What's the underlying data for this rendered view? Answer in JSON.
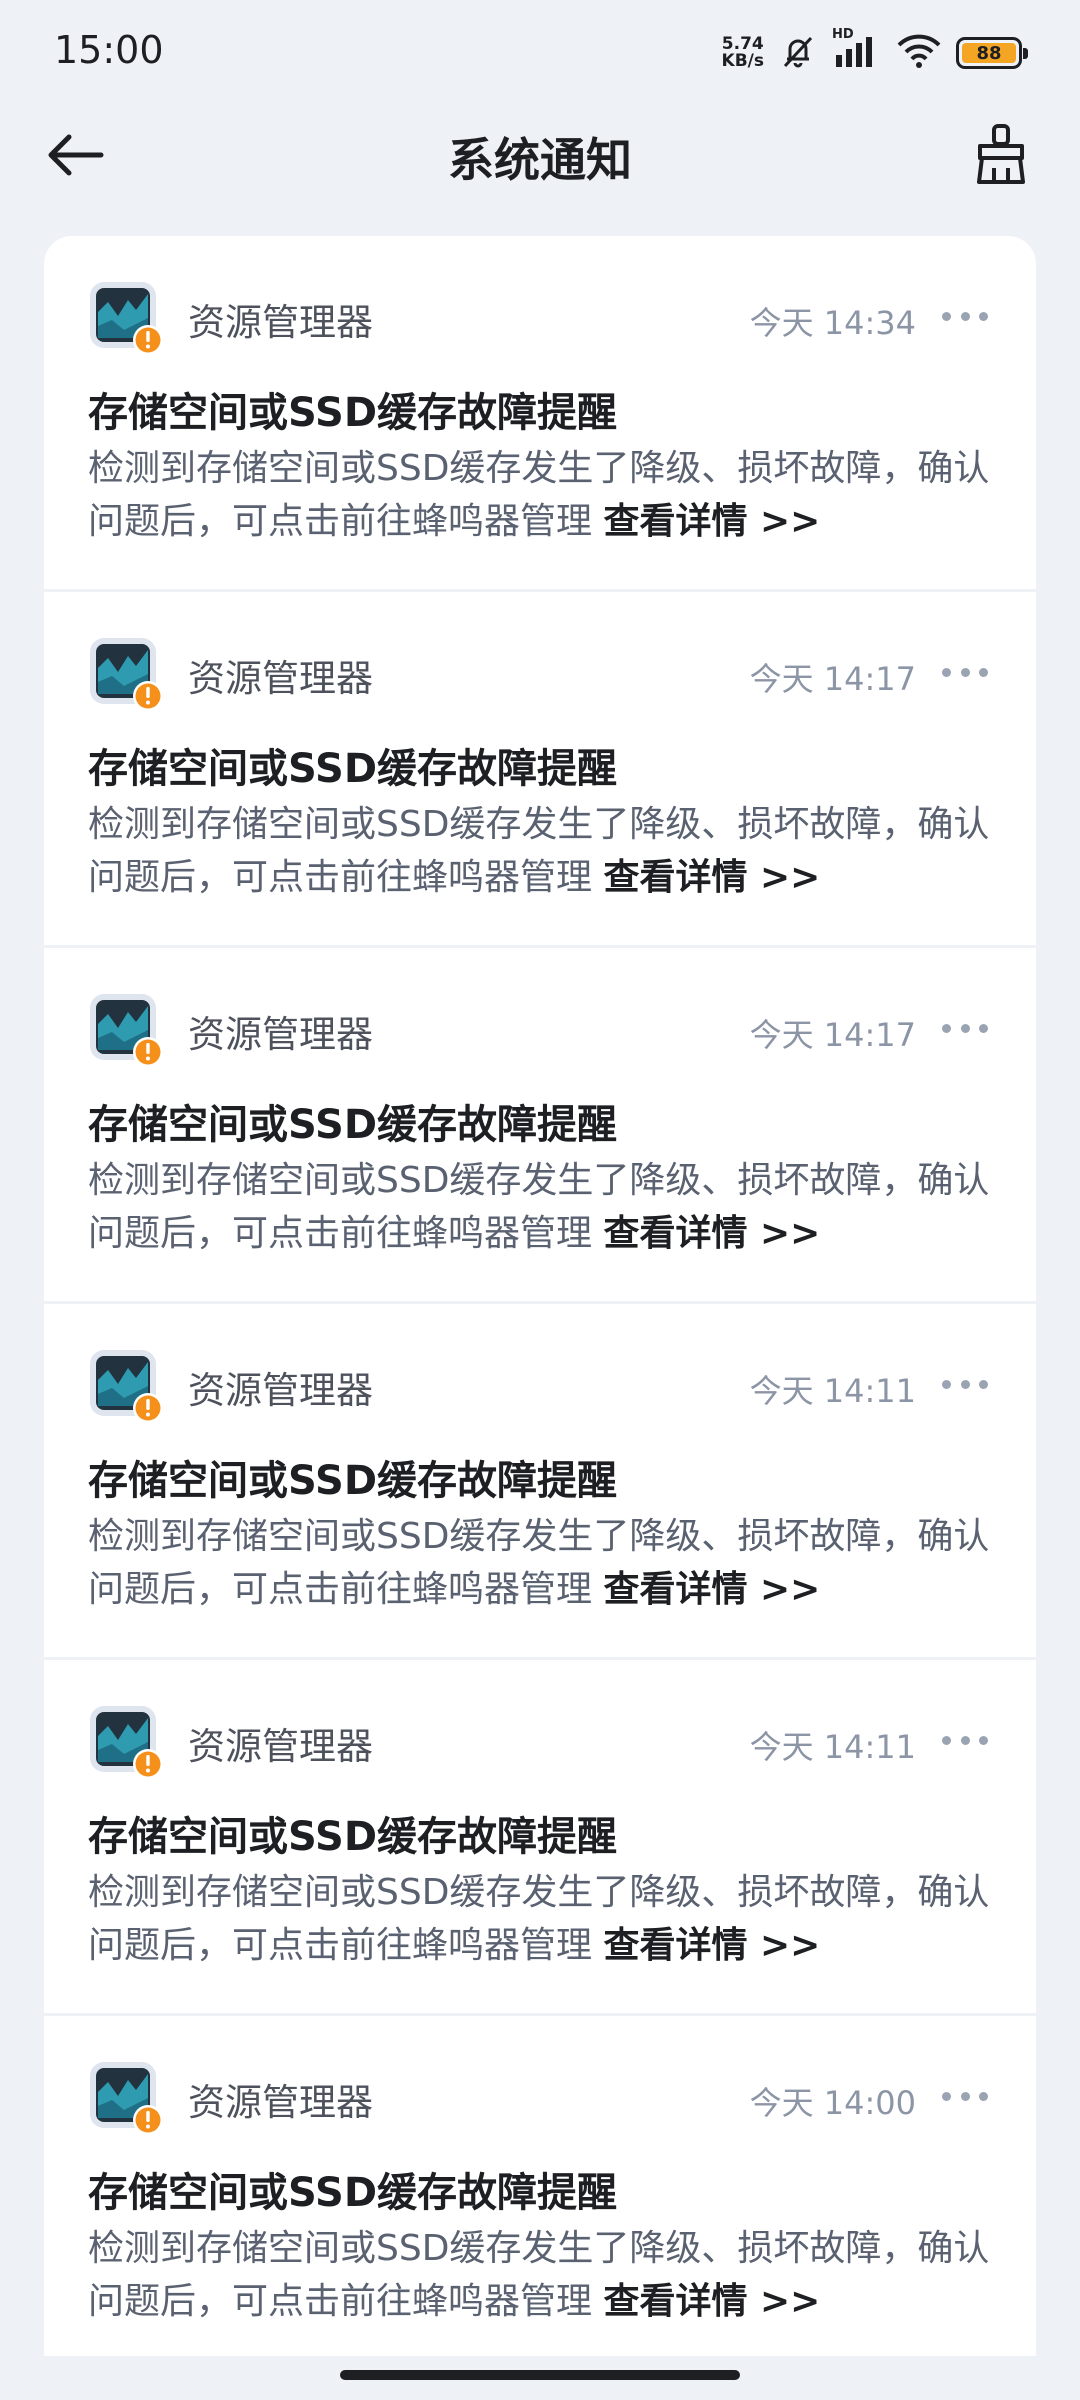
{
  "status_bar": {
    "time": "15:00",
    "speed_value": "5.74",
    "speed_unit": "KB/s",
    "signal_label": "HD",
    "battery": "88",
    "icons": [
      "mute-bell-icon",
      "signal-icon",
      "wifi-icon",
      "battery-icon"
    ]
  },
  "header": {
    "title": "系统通知",
    "back_icon": "back-arrow-icon",
    "clear_icon": "broom-clear-icon"
  },
  "notifications": [
    {
      "app": "资源管理器",
      "time": "今天 14:34",
      "title": "存储空间或SSD缓存故障提醒",
      "body": "检测到存储空间或SSD缓存发生了降级、损坏故障，确认问题后，可点击前往蜂鸣器管理 ",
      "link": "查看详情 >>"
    },
    {
      "app": "资源管理器",
      "time": "今天 14:17",
      "title": "存储空间或SSD缓存故障提醒",
      "body": "检测到存储空间或SSD缓存发生了降级、损坏故障，确认问题后，可点击前往蜂鸣器管理 ",
      "link": "查看详情 >>"
    },
    {
      "app": "资源管理器",
      "time": "今天 14:17",
      "title": "存储空间或SSD缓存故障提醒",
      "body": "检测到存储空间或SSD缓存发生了降级、损坏故障，确认问题后，可点击前往蜂鸣器管理 ",
      "link": "查看详情 >>"
    },
    {
      "app": "资源管理器",
      "time": "今天 14:11",
      "title": "存储空间或SSD缓存故障提醒",
      "body": "检测到存储空间或SSD缓存发生了降级、损坏故障，确认问题后，可点击前往蜂鸣器管理 ",
      "link": "查看详情 >>"
    },
    {
      "app": "资源管理器",
      "time": "今天 14:11",
      "title": "存储空间或SSD缓存故障提醒",
      "body": "检测到存储空间或SSD缓存发生了降级、损坏故障，确认问题后，可点击前往蜂鸣器管理 ",
      "link": "查看详情 >>"
    },
    {
      "app": "资源管理器",
      "time": "今天 14:00",
      "title": "存储空间或SSD缓存故障提醒",
      "body": "检测到存储空间或SSD缓存发生了降级、损坏故障，确认问题后，可点击前往蜂鸣器管理 ",
      "link": "查看详情 >>"
    }
  ],
  "colors": {
    "background": "#eef1f6",
    "card": "#ffffff",
    "badge": "#f5901a",
    "battery": "#f4a524"
  }
}
